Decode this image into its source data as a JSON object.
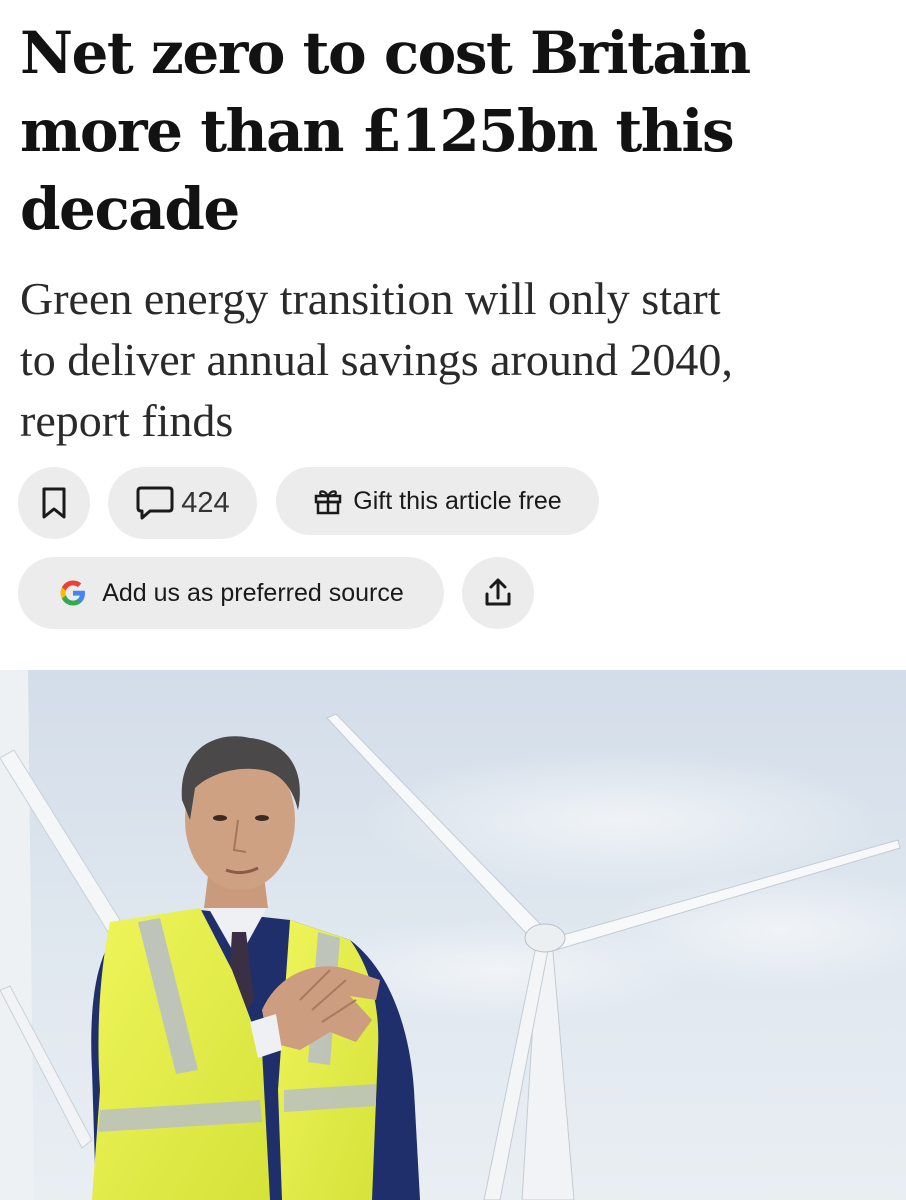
{
  "article": {
    "headline_lines": [
      "Net zero to cost Britain",
      "more than £125bn this",
      "decade"
    ],
    "standfirst_lines": [
      "Green energy transition will only start",
      "to deliver annual savings around 2040,",
      "report finds"
    ]
  },
  "actions": {
    "bookmark_icon": "bookmark-icon",
    "comments_icon": "comment-bubble-icon",
    "comment_count": "424",
    "gift_icon": "gift-icon",
    "gift_label": "Gift this article free",
    "google_icon": "google-g-icon",
    "preferred_label": "Add us as preferred source",
    "share_icon": "share-upload-icon"
  },
  "image": {
    "subject": "hero-photo",
    "colors": {
      "sky": "#dbe4ee",
      "vest": "#e9f24a",
      "jacket": "#1e2f6b",
      "turbine": "#f4f6f8"
    }
  },
  "colors": {
    "pill_bg": "#ececec",
    "text": "#121212",
    "google_blue": "#4285F4",
    "google_red": "#EA4335",
    "google_yellow": "#FBBC05",
    "google_green": "#34A853"
  }
}
